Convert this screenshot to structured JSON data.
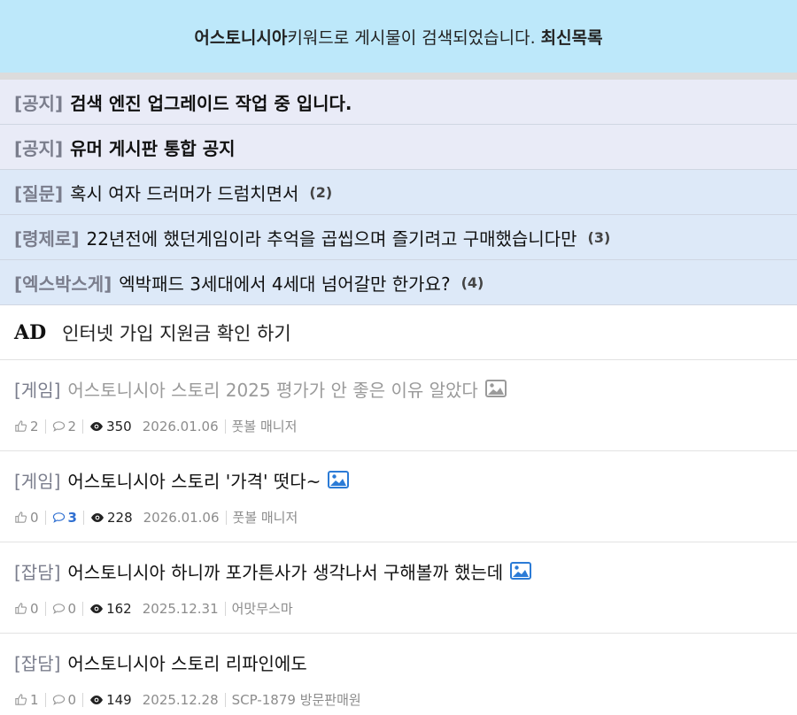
{
  "banner": {
    "keyword": "어스토니시아",
    "message": " 키워드로 게시물이 검색되었습니다.",
    "latest_label": "최신목록"
  },
  "pinned": [
    {
      "category": "[공지]",
      "title": "검색 엔진 업그레이드 작업 중 입니다.",
      "count": ""
    },
    {
      "category": "[공지]",
      "title": "유머 게시판 통합 공지",
      "count": ""
    },
    {
      "category": "[질문]",
      "title": "혹시 여자 드러머가 드럼치면서",
      "count": "(2)"
    },
    {
      "category": "[령제로]",
      "title": "22년전에 했던게임이라 추억을 곱씹으며 즐기려고 구매했습니다만",
      "count": "(3)"
    },
    {
      "category": "[엑스박스게]",
      "title": "엑박패드 3세대에서 4세대 넘어갈만 한가요?",
      "count": "(4)"
    }
  ],
  "ad": {
    "badge": "AD",
    "text": "인터넷 가입 지원금 확인 하기"
  },
  "posts": [
    {
      "category": "[게임]",
      "title": "어스토니시아 스토리 2025 평가가 안 좋은 이유 알았다",
      "likes": "2",
      "comments": "2",
      "views": "350",
      "date": "2026.01.06",
      "author": "풋볼 매니저"
    },
    {
      "category": "[게임]",
      "title": "어스토니시아 스토리 '가격' 떳다~",
      "likes": "0",
      "comments": "3",
      "views": "228",
      "date": "2026.01.06",
      "author": "풋볼 매니저"
    },
    {
      "category": "[잡담]",
      "title": "어스토니시아 하니까 포가튼사가 생각나서 구해볼까 했는데",
      "likes": "0",
      "comments": "0",
      "views": "162",
      "date": "2025.12.31",
      "author": "어맛무스마"
    },
    {
      "category": "[잡담]",
      "title": "어스토니시아 스토리 리파인에도",
      "likes": "1",
      "comments": "0",
      "views": "149",
      "date": "2025.12.28",
      "author": "SCP-1879 방문판매원"
    }
  ],
  "icons": {
    "like": "thumbs-up-icon",
    "comment": "comment-bubble-icon",
    "views": "eye-icon",
    "image": "image-icon"
  },
  "colors": {
    "banner_bg": "#bde8fa",
    "notice_bg": "#e9ebf7",
    "hot_bg": "#dde9f8",
    "comment_accent": "#2f6fd1"
  }
}
